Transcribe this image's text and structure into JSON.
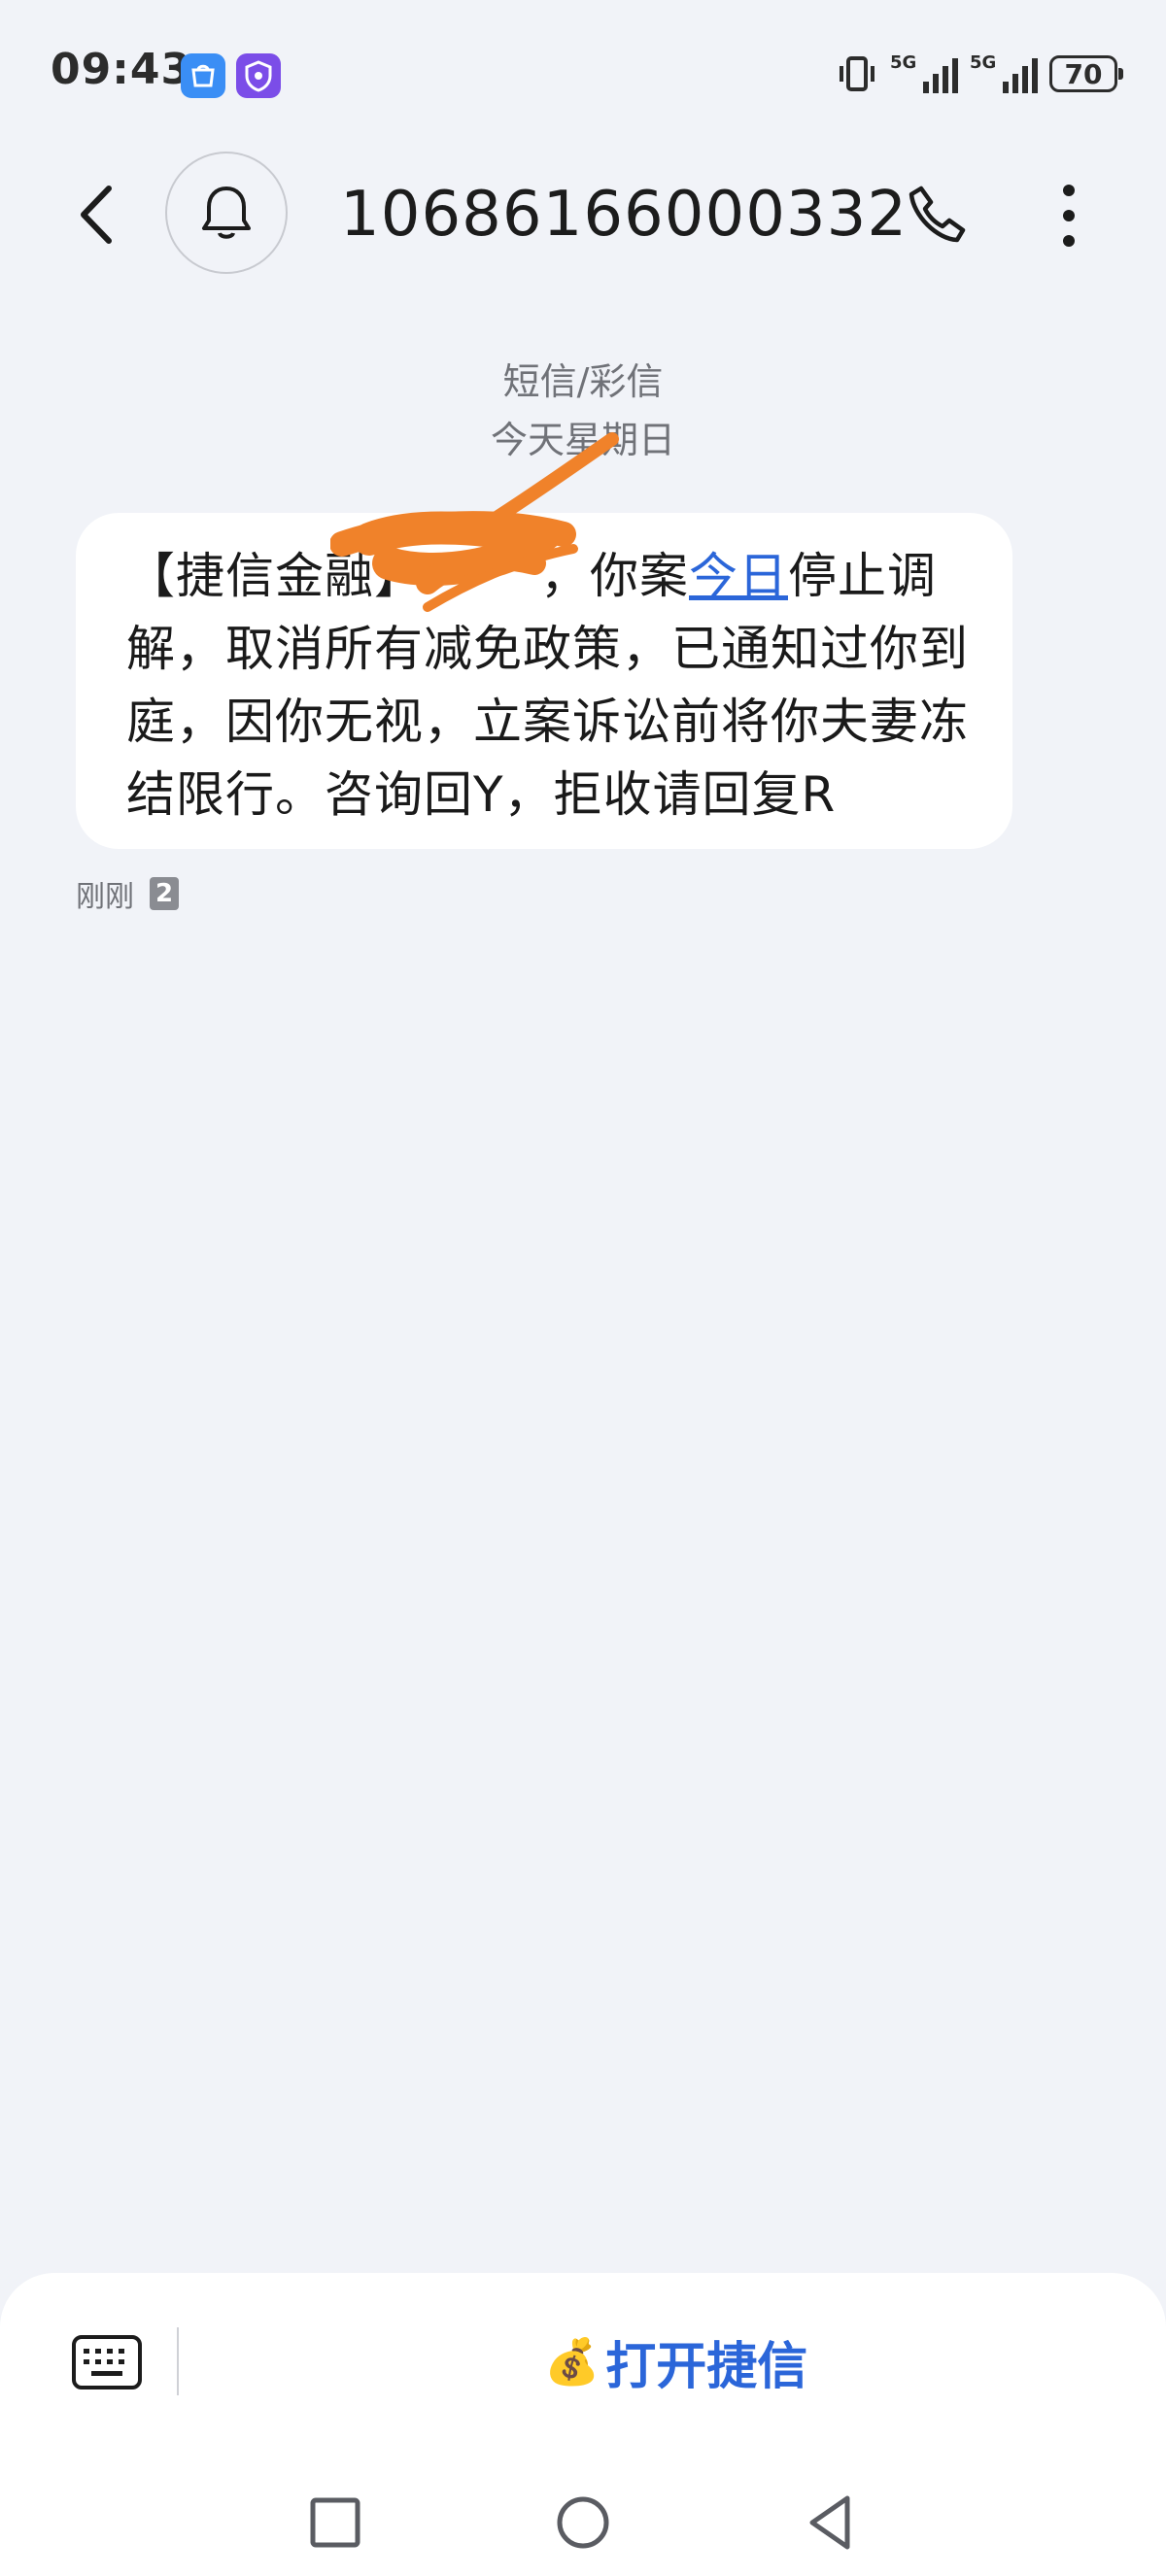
{
  "status_bar": {
    "time": "09:43",
    "network_1": "5G",
    "network_2": "5G",
    "battery": "70"
  },
  "header": {
    "contact": "10686166000332",
    "icons": {
      "back": "back-arrow-icon",
      "avatar": "bell-icon",
      "call": "phone-icon",
      "more": "more-vertical-icon"
    }
  },
  "thread": {
    "type_label": "短信/彩信",
    "date_label": "今天星期日"
  },
  "message": {
    "text_before": "【捷信金融】",
    "text_after_redaction": "，你案",
    "link_text": "今日",
    "text_after_link": "停止调解，取消所有减免政策，已通知过你到庭，因你无视，立案诉讼前将你夫妻冻结限行。咨询回Y，拒收请回复R",
    "time": "刚刚",
    "sim": "2"
  },
  "bottom_bar": {
    "open_app_label": "打开捷信",
    "icons": {
      "keyboard": "keyboard-icon",
      "money": "money-bag-icon"
    }
  },
  "colors": {
    "background": "#f1f3f8",
    "bubble": "#ffffff",
    "link": "#2b66d9",
    "redaction": "#f0822a"
  }
}
